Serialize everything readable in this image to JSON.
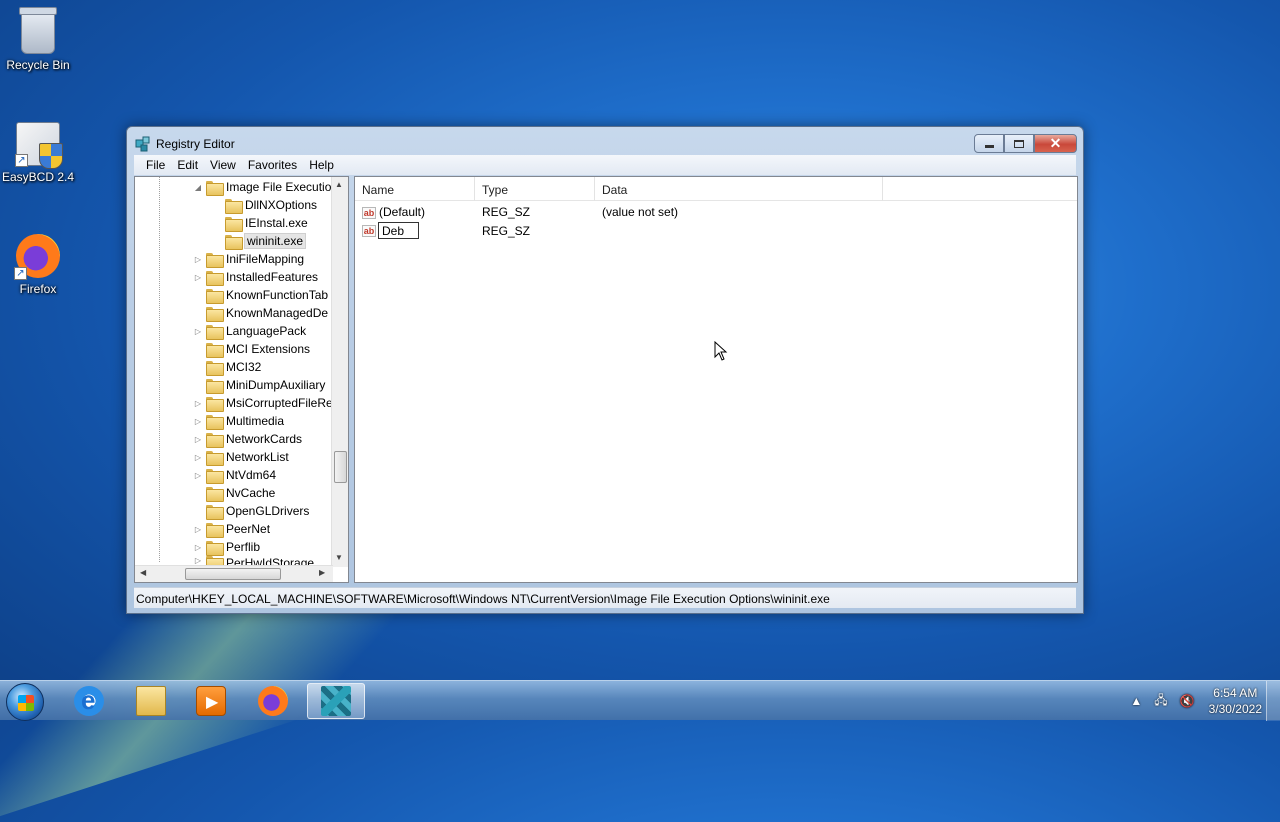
{
  "desktop": {
    "icons": [
      {
        "label": "Recycle Bin",
        "icon": "recycle-bin-icon"
      },
      {
        "label": "EasyBCD 2.4",
        "icon": "easybcd-icon"
      },
      {
        "label": "Firefox",
        "icon": "firefox-icon"
      }
    ]
  },
  "window": {
    "title": "Registry Editor",
    "menu": [
      "File",
      "Edit",
      "View",
      "Favorites",
      "Help"
    ],
    "tree": {
      "items": [
        {
          "label": "Image File Executio",
          "expanded": true
        },
        {
          "label": "DllNXOptions"
        },
        {
          "label": "IEInstal.exe"
        },
        {
          "label": "wininit.exe",
          "selected": true
        },
        {
          "label": "IniFileMapping"
        },
        {
          "label": "InstalledFeatures"
        },
        {
          "label": "KnownFunctionTab"
        },
        {
          "label": "KnownManagedDe"
        },
        {
          "label": "LanguagePack"
        },
        {
          "label": "MCI Extensions"
        },
        {
          "label": "MCI32"
        },
        {
          "label": "MiniDumpAuxiliary"
        },
        {
          "label": "MsiCorruptedFileRe"
        },
        {
          "label": "Multimedia"
        },
        {
          "label": "NetworkCards"
        },
        {
          "label": "NetworkList"
        },
        {
          "label": "NtVdm64"
        },
        {
          "label": "NvCache"
        },
        {
          "label": "OpenGLDrivers"
        },
        {
          "label": "PeerNet"
        },
        {
          "label": "Perflib"
        },
        {
          "label": "PerHwIdStorage"
        }
      ]
    },
    "list": {
      "columns": [
        "Name",
        "Type",
        "Data"
      ],
      "rows": [
        {
          "name": "(Default)",
          "type": "REG_SZ",
          "data": "(value not set)"
        },
        {
          "name": "Deb",
          "type": "REG_SZ",
          "data": "",
          "editing": true
        }
      ]
    },
    "status": "Computer\\HKEY_LOCAL_MACHINE\\SOFTWARE\\Microsoft\\Windows NT\\CurrentVersion\\Image File Execution Options\\wininit.exe"
  },
  "taskbar": {
    "apps": [
      "Internet Explorer",
      "Windows Explorer",
      "Windows Media Player",
      "Firefox",
      "Registry Editor"
    ],
    "clock": {
      "time": "6:54 AM",
      "date": "3/30/2022"
    }
  }
}
